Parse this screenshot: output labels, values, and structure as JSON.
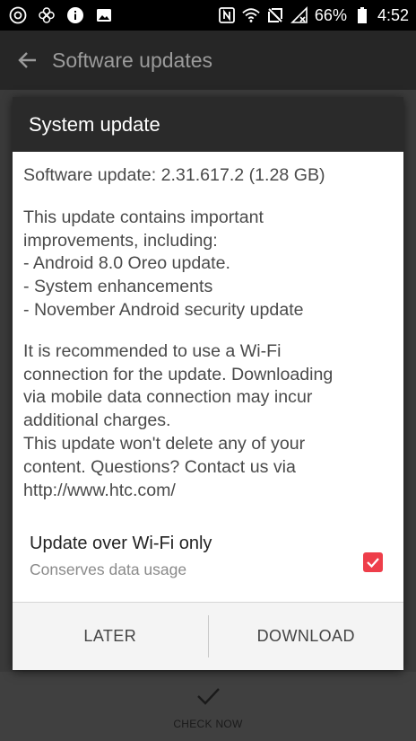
{
  "status_bar": {
    "battery": "66%",
    "time": "4:52"
  },
  "app_bar": {
    "title": "Software updates"
  },
  "dialog": {
    "title": "System update",
    "version_line": "Software update: 2.31.617.2 (1.28 GB)",
    "improvements": "This update contains important\nimprovements, including:\n- Android 8.0 Oreo update.\n- System enhancements\n- November Android security update",
    "recommendation": "It is recommended to use a Wi-Fi\nconnection for the update. Downloading\nvia mobile data connection may incur\nadditional charges.\nThis update won't delete any of your\ncontent. Questions? Contact us via\nhttp://www.htc.com/",
    "wifi_option": {
      "title": "Update over Wi-Fi only",
      "subtitle": "Conserves data usage",
      "checked": true
    },
    "buttons": {
      "later": "LATER",
      "download": "DOWNLOAD"
    }
  },
  "bottom_bar": {
    "label": "CHECK NOW"
  },
  "colors": {
    "accent": "#ee3e4a",
    "header": "#2a2a2a"
  }
}
